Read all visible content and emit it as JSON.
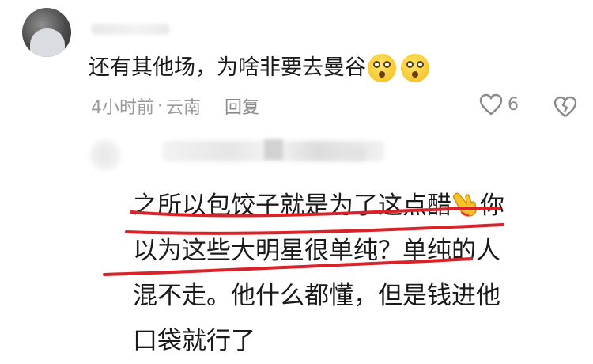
{
  "comment": {
    "text": "还有其他场，为啥非要去曼谷",
    "emojis": [
      "astonished-face-icon",
      "astonished-face-icon"
    ],
    "time": "4小时前",
    "separator": "·",
    "location": "云南",
    "reply_label": "回复",
    "like_count": "6"
  },
  "reply": {
    "lines": [
      "之所以包饺子就是为了这点醋",
      "你",
      "以为这些大明星很单纯？单纯的人",
      "混不走。他什么都懂，但是钱进他",
      "口袋就行了"
    ],
    "emoji": "pointing-hand-icon",
    "underline_color": "#d8232a"
  }
}
